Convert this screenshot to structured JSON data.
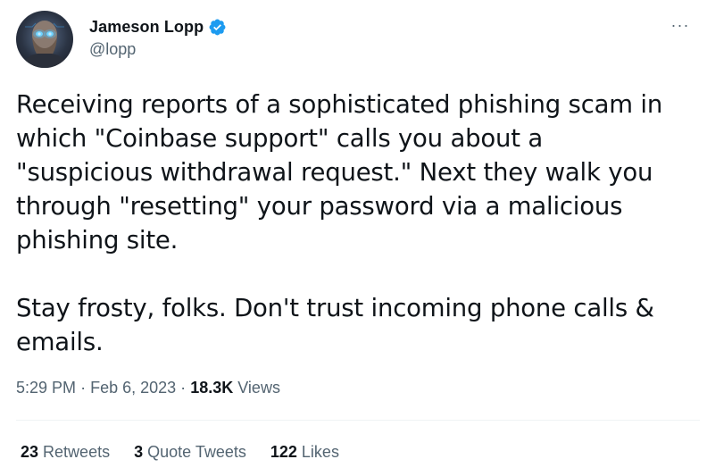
{
  "author": {
    "display_name": "Jameson Lopp",
    "handle": "@lopp",
    "verified": true,
    "avatar_icon": "profile-photo"
  },
  "menu": {
    "more_label": "···"
  },
  "tweet": {
    "text": "Receiving reports of a sophisticated phishing scam in\nwhich \"Coinbase support\" calls you about a\n\"suspicious withdrawal request.\" Next they walk you\nthrough \"resetting\" your password via a malicious\nphishing site.\n\nStay frosty, folks. Don't trust incoming phone calls &\nemails."
  },
  "meta": {
    "time": "5:29 PM",
    "separator": "·",
    "date": "Feb 6, 2023",
    "views_count": "18.3K",
    "views_label": "Views"
  },
  "stats": {
    "retweets_count": "23",
    "retweets_label": "Retweets",
    "quotes_count": "3",
    "quotes_label": "Quote Tweets",
    "likes_count": "122",
    "likes_label": "Likes"
  },
  "colors": {
    "text_primary": "#0f1419",
    "text_secondary": "#536471",
    "verified_blue": "#1d9bf0",
    "divider": "#eff3f4"
  }
}
